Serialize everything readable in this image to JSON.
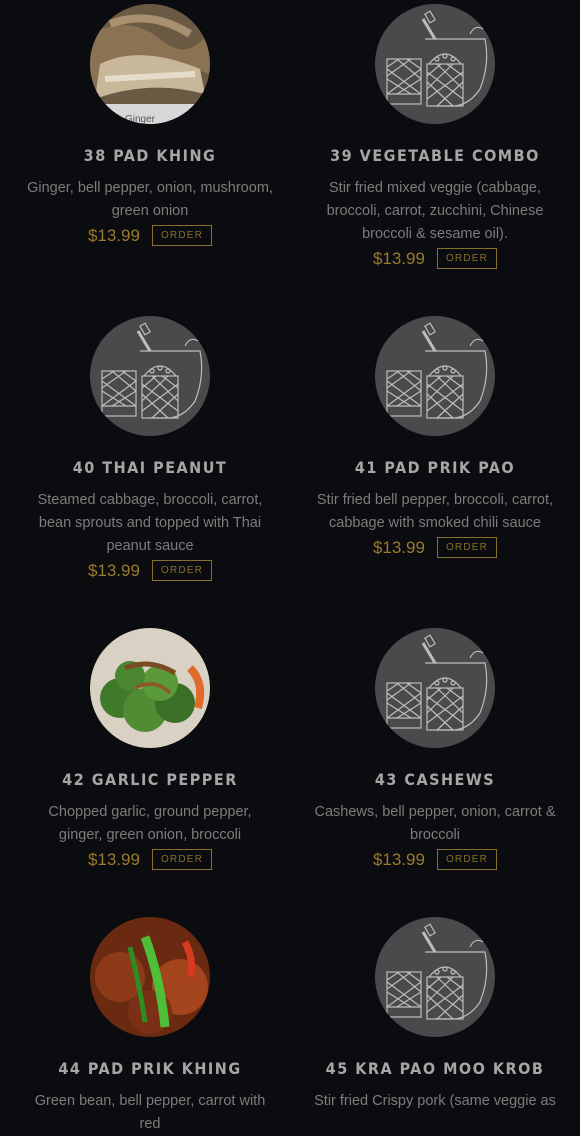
{
  "items": [
    {
      "name": "38 PAD KHING",
      "desc": "Ginger, bell pepper, onion, mushroom, green onion",
      "price": "$13.99",
      "order": "ORDER",
      "image_caption": "Ginger"
    },
    {
      "name": "39 VEGETABLE COMBO",
      "desc": "Stir fried mixed veggie (cabbage, broccoli, carrot, zucchini, Chinese broccoli & sesame oil).",
      "price": "$13.99",
      "order": "ORDER"
    },
    {
      "name": "40 THAI PEANUT",
      "desc": "Steamed cabbage, broccoli, carrot, bean sprouts and topped with Thai peanut sauce",
      "price": "$13.99",
      "order": "ORDER"
    },
    {
      "name": "41 PAD PRIK PAO",
      "desc": "Stir fried bell pepper, broccoli, carrot, cabbage with smoked chili sauce",
      "price": "$13.99",
      "order": "ORDER"
    },
    {
      "name": "42 GARLIC PEPPER",
      "desc": "Chopped garlic, ground pepper, ginger, green onion, broccoli",
      "price": "$13.99",
      "order": "ORDER"
    },
    {
      "name": "43 CASHEWS",
      "desc": "Cashews, bell pepper, onion, carrot & broccoli",
      "price": "$13.99",
      "order": "ORDER"
    },
    {
      "name": "44 PAD PRIK KHING",
      "desc": "Green bean, bell pepper, carrot with red",
      "price": "",
      "order": ""
    },
    {
      "name": "45 KRA PAO MOO KROB",
      "desc": "Stir fried Crispy pork (same veggie as",
      "price": "",
      "order": ""
    }
  ],
  "colors": {
    "background": "#0b0c0f",
    "price": "#9a7a2e",
    "title": "#a6a6a6"
  }
}
